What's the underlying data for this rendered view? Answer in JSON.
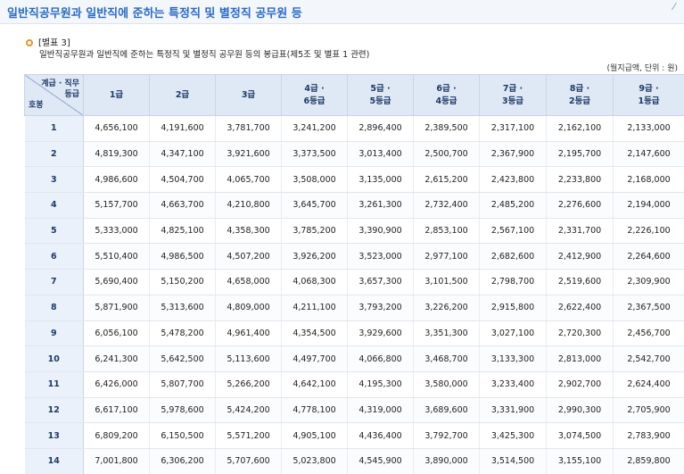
{
  "page": {
    "title": "일반직공무원과 일반직에 준하는 특정직 및 별정직 공무원 등",
    "annex_label": "[별표 3]",
    "annex_subtitle": "일반직공무원과 일반직에 준하는 특정직 및 별정직 공무원 등의 봉급표(제5조 및 별표 1 관련)",
    "unit_note": "(월지급액, 단위 : 원)"
  },
  "table": {
    "corner_top": "계급 · 직무\n등급",
    "corner_bottom": "호봉",
    "columns": [
      "1급",
      "2급",
      "3급",
      "4급 ·\n6등급",
      "5급 ·\n5등급",
      "6급 ·\n4등급",
      "7급 ·\n3등급",
      "8급 ·\n2등급",
      "9급 ·\n1등급"
    ],
    "rows": [
      {
        "step": "1",
        "values": [
          "4,656,100",
          "4,191,600",
          "3,781,700",
          "3,241,200",
          "2,896,400",
          "2,389,500",
          "2,317,100",
          "2,162,100",
          "2,133,000"
        ]
      },
      {
        "step": "2",
        "values": [
          "4,819,300",
          "4,347,100",
          "3,921,600",
          "3,373,500",
          "3,013,400",
          "2,500,700",
          "2,367,900",
          "2,195,700",
          "2,147,600"
        ]
      },
      {
        "step": "3",
        "values": [
          "4,986,600",
          "4,504,700",
          "4,065,700",
          "3,508,000",
          "3,135,000",
          "2,615,200",
          "2,423,800",
          "2,233,800",
          "2,168,000"
        ]
      },
      {
        "step": "4",
        "values": [
          "5,157,700",
          "4,663,700",
          "4,210,800",
          "3,645,700",
          "3,261,300",
          "2,732,400",
          "2,485,200",
          "2,276,600",
          "2,194,000"
        ]
      },
      {
        "step": "5",
        "values": [
          "5,333,000",
          "4,825,100",
          "4,358,300",
          "3,785,200",
          "3,390,900",
          "2,853,100",
          "2,567,100",
          "2,331,700",
          "2,226,100"
        ]
      },
      {
        "step": "6",
        "values": [
          "5,510,400",
          "4,986,500",
          "4,507,200",
          "3,926,200",
          "3,523,000",
          "2,977,100",
          "2,682,600",
          "2,412,900",
          "2,264,600"
        ]
      },
      {
        "step": "7",
        "values": [
          "5,690,400",
          "5,150,200",
          "4,658,000",
          "4,068,300",
          "3,657,300",
          "3,101,500",
          "2,798,700",
          "2,519,600",
          "2,309,900"
        ]
      },
      {
        "step": "8",
        "values": [
          "5,871,900",
          "5,313,600",
          "4,809,000",
          "4,211,100",
          "3,793,200",
          "3,226,200",
          "2,915,800",
          "2,622,400",
          "2,367,500"
        ]
      },
      {
        "step": "9",
        "values": [
          "6,056,100",
          "5,478,200",
          "4,961,400",
          "4,354,500",
          "3,929,600",
          "3,351,300",
          "3,027,100",
          "2,720,300",
          "2,456,700"
        ]
      },
      {
        "step": "10",
        "values": [
          "6,241,300",
          "5,642,500",
          "5,113,600",
          "4,497,700",
          "4,066,800",
          "3,468,700",
          "3,133,300",
          "2,813,000",
          "2,542,700"
        ]
      },
      {
        "step": "11",
        "values": [
          "6,426,000",
          "5,807,700",
          "5,266,200",
          "4,642,100",
          "4,195,300",
          "3,580,000",
          "3,233,400",
          "2,902,700",
          "2,624,400"
        ]
      },
      {
        "step": "12",
        "values": [
          "6,617,100",
          "5,978,600",
          "5,424,200",
          "4,778,100",
          "4,319,000",
          "3,689,600",
          "3,331,900",
          "2,990,300",
          "2,705,900"
        ]
      },
      {
        "step": "13",
        "values": [
          "6,809,200",
          "6,150,500",
          "5,571,200",
          "4,905,100",
          "4,436,400",
          "3,792,700",
          "3,425,300",
          "3,074,500",
          "2,783,900"
        ]
      },
      {
        "step": "14",
        "values": [
          "7,001,800",
          "6,306,200",
          "5,707,600",
          "5,023,800",
          "4,545,900",
          "3,890,000",
          "3,514,500",
          "3,155,100",
          "2,859,800"
        ]
      }
    ]
  }
}
